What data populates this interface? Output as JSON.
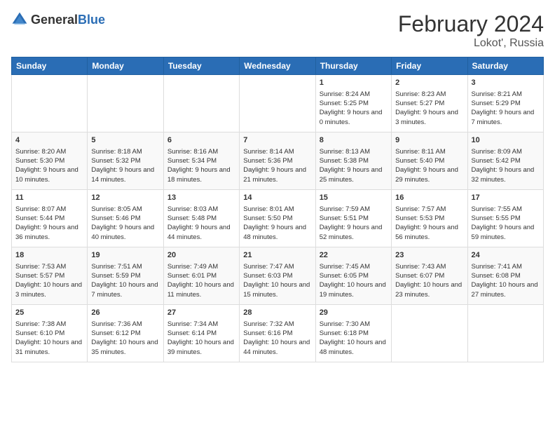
{
  "header": {
    "logo_general": "General",
    "logo_blue": "Blue",
    "title": "February 2024",
    "location": "Lokot', Russia"
  },
  "days_of_week": [
    "Sunday",
    "Monday",
    "Tuesday",
    "Wednesday",
    "Thursday",
    "Friday",
    "Saturday"
  ],
  "weeks": [
    [
      {
        "day": "",
        "info": ""
      },
      {
        "day": "",
        "info": ""
      },
      {
        "day": "",
        "info": ""
      },
      {
        "day": "",
        "info": ""
      },
      {
        "day": "1",
        "info": "Sunrise: 8:24 AM\nSunset: 5:25 PM\nDaylight: 9 hours and 0 minutes."
      },
      {
        "day": "2",
        "info": "Sunrise: 8:23 AM\nSunset: 5:27 PM\nDaylight: 9 hours and 3 minutes."
      },
      {
        "day": "3",
        "info": "Sunrise: 8:21 AM\nSunset: 5:29 PM\nDaylight: 9 hours and 7 minutes."
      }
    ],
    [
      {
        "day": "4",
        "info": "Sunrise: 8:20 AM\nSunset: 5:30 PM\nDaylight: 9 hours and 10 minutes."
      },
      {
        "day": "5",
        "info": "Sunrise: 8:18 AM\nSunset: 5:32 PM\nDaylight: 9 hours and 14 minutes."
      },
      {
        "day": "6",
        "info": "Sunrise: 8:16 AM\nSunset: 5:34 PM\nDaylight: 9 hours and 18 minutes."
      },
      {
        "day": "7",
        "info": "Sunrise: 8:14 AM\nSunset: 5:36 PM\nDaylight: 9 hours and 21 minutes."
      },
      {
        "day": "8",
        "info": "Sunrise: 8:13 AM\nSunset: 5:38 PM\nDaylight: 9 hours and 25 minutes."
      },
      {
        "day": "9",
        "info": "Sunrise: 8:11 AM\nSunset: 5:40 PM\nDaylight: 9 hours and 29 minutes."
      },
      {
        "day": "10",
        "info": "Sunrise: 8:09 AM\nSunset: 5:42 PM\nDaylight: 9 hours and 32 minutes."
      }
    ],
    [
      {
        "day": "11",
        "info": "Sunrise: 8:07 AM\nSunset: 5:44 PM\nDaylight: 9 hours and 36 minutes."
      },
      {
        "day": "12",
        "info": "Sunrise: 8:05 AM\nSunset: 5:46 PM\nDaylight: 9 hours and 40 minutes."
      },
      {
        "day": "13",
        "info": "Sunrise: 8:03 AM\nSunset: 5:48 PM\nDaylight: 9 hours and 44 minutes."
      },
      {
        "day": "14",
        "info": "Sunrise: 8:01 AM\nSunset: 5:50 PM\nDaylight: 9 hours and 48 minutes."
      },
      {
        "day": "15",
        "info": "Sunrise: 7:59 AM\nSunset: 5:51 PM\nDaylight: 9 hours and 52 minutes."
      },
      {
        "day": "16",
        "info": "Sunrise: 7:57 AM\nSunset: 5:53 PM\nDaylight: 9 hours and 56 minutes."
      },
      {
        "day": "17",
        "info": "Sunrise: 7:55 AM\nSunset: 5:55 PM\nDaylight: 9 hours and 59 minutes."
      }
    ],
    [
      {
        "day": "18",
        "info": "Sunrise: 7:53 AM\nSunset: 5:57 PM\nDaylight: 10 hours and 3 minutes."
      },
      {
        "day": "19",
        "info": "Sunrise: 7:51 AM\nSunset: 5:59 PM\nDaylight: 10 hours and 7 minutes."
      },
      {
        "day": "20",
        "info": "Sunrise: 7:49 AM\nSunset: 6:01 PM\nDaylight: 10 hours and 11 minutes."
      },
      {
        "day": "21",
        "info": "Sunrise: 7:47 AM\nSunset: 6:03 PM\nDaylight: 10 hours and 15 minutes."
      },
      {
        "day": "22",
        "info": "Sunrise: 7:45 AM\nSunset: 6:05 PM\nDaylight: 10 hours and 19 minutes."
      },
      {
        "day": "23",
        "info": "Sunrise: 7:43 AM\nSunset: 6:07 PM\nDaylight: 10 hours and 23 minutes."
      },
      {
        "day": "24",
        "info": "Sunrise: 7:41 AM\nSunset: 6:08 PM\nDaylight: 10 hours and 27 minutes."
      }
    ],
    [
      {
        "day": "25",
        "info": "Sunrise: 7:38 AM\nSunset: 6:10 PM\nDaylight: 10 hours and 31 minutes."
      },
      {
        "day": "26",
        "info": "Sunrise: 7:36 AM\nSunset: 6:12 PM\nDaylight: 10 hours and 35 minutes."
      },
      {
        "day": "27",
        "info": "Sunrise: 7:34 AM\nSunset: 6:14 PM\nDaylight: 10 hours and 39 minutes."
      },
      {
        "day": "28",
        "info": "Sunrise: 7:32 AM\nSunset: 6:16 PM\nDaylight: 10 hours and 44 minutes."
      },
      {
        "day": "29",
        "info": "Sunrise: 7:30 AM\nSunset: 6:18 PM\nDaylight: 10 hours and 48 minutes."
      },
      {
        "day": "",
        "info": ""
      },
      {
        "day": "",
        "info": ""
      }
    ]
  ]
}
